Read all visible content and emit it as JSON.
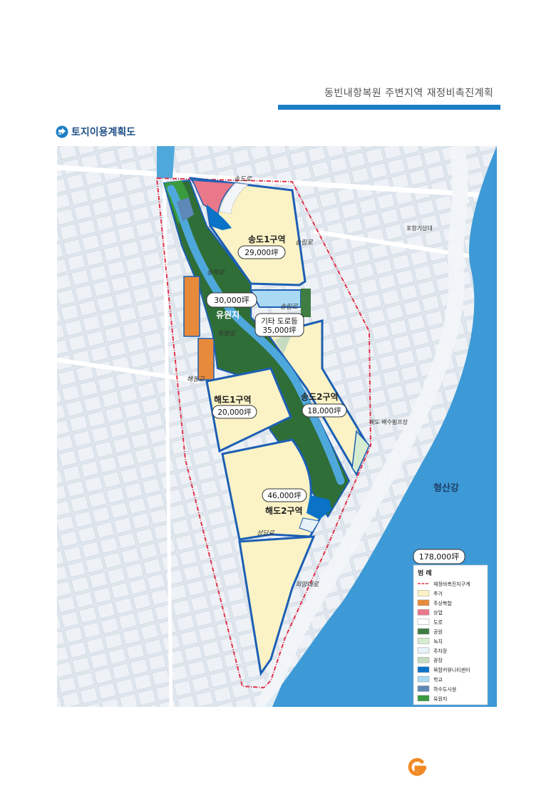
{
  "header": {
    "doc_title": "동빈내항복원 주변지역 재정비촉진계획",
    "section_title": "토지이용계획도"
  },
  "colors": {
    "accent": "#1b7fc6",
    "river": "#4fa8dc",
    "boundary": "#e0334a",
    "zone_outline": "#1c5fb4"
  },
  "map": {
    "roads": [
      "송도로",
      "송림로",
      "송림로",
      "송하로",
      "죽항로",
      "해동교",
      "성당로",
      "희망대로"
    ],
    "places": [
      "포항기상대",
      "해도 배수펌프장",
      "형산강"
    ],
    "zones": [
      {
        "name": "송도1구역",
        "area": "29,000坪"
      },
      {
        "name": "유원지",
        "area": "30,000坪"
      },
      {
        "name": "기타 도로등",
        "area": "35,000坪"
      },
      {
        "name": "송도2구역",
        "area": "18,000坪"
      },
      {
        "name": "해도1구역",
        "area": "20,000坪"
      },
      {
        "name": "해도2구역",
        "area": "46,000坪"
      }
    ],
    "total": "178,000坪"
  },
  "legend": {
    "title": "범 례",
    "items": [
      {
        "label": "재정비촉진지구계",
        "color": "#e0334a",
        "type": "line"
      },
      {
        "label": "주거",
        "color": "#fbf3c6",
        "type": "box"
      },
      {
        "label": "주상복합",
        "color": "#e88a3c",
        "type": "box"
      },
      {
        "label": "상업",
        "color": "#e9788a",
        "type": "box"
      },
      {
        "label": "도로",
        "color": "#ffffff",
        "type": "box"
      },
      {
        "label": "공원",
        "color": "#3f7d43",
        "type": "box"
      },
      {
        "label": "녹지",
        "color": "#d6ecd0",
        "type": "box"
      },
      {
        "label": "주차장",
        "color": "#e6f1f8",
        "type": "box"
      },
      {
        "label": "광장",
        "color": "#c6dcc1",
        "type": "box"
      },
      {
        "label": "복합커뮤니티센터",
        "color": "#0a72c7",
        "type": "box"
      },
      {
        "label": "학교",
        "color": "#a9d9f3",
        "type": "box"
      },
      {
        "label": "하수도시설",
        "color": "#5d88b8",
        "type": "box"
      },
      {
        "label": "유원지",
        "color": "#3a9a3f",
        "type": "box"
      }
    ]
  }
}
